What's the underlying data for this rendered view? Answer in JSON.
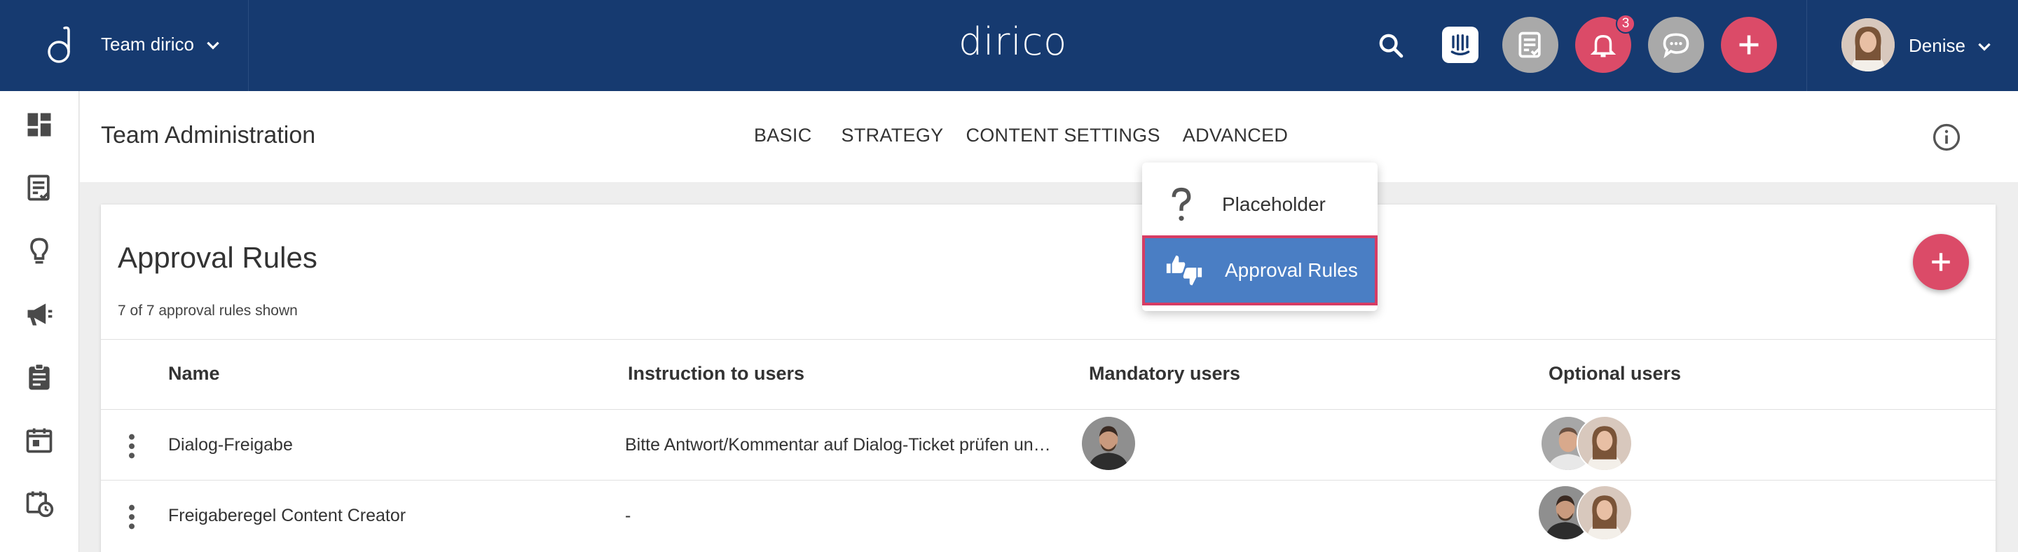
{
  "topbar": {
    "team_name": "Team dirico",
    "brand": "dirico",
    "notification_count": "3",
    "user_name": "Denise",
    "colors": {
      "bar": "#163a70",
      "accent": "#db4b68",
      "grey_btn": "#a9a9a9"
    }
  },
  "sidebar": {
    "items": [
      {
        "icon": "dashboard-icon"
      },
      {
        "icon": "task-list-icon"
      },
      {
        "icon": "lightbulb-icon"
      },
      {
        "icon": "megaphone-icon"
      },
      {
        "icon": "clipboard-icon"
      },
      {
        "icon": "calendar-icon"
      },
      {
        "icon": "calendar-clock-icon"
      }
    ]
  },
  "header": {
    "title": "Team Administration",
    "tabs": [
      {
        "label": "BASIC"
      },
      {
        "label": "STRATEGY"
      },
      {
        "label": "CONTENT SETTINGS"
      },
      {
        "label": "ADVANCED"
      }
    ]
  },
  "dropdown": {
    "items": [
      {
        "label": "Placeholder",
        "icon": "question-mark-icon"
      },
      {
        "label": "Approval Rules",
        "icon": "thumbs-up-down-icon",
        "selected": true
      }
    ]
  },
  "card": {
    "title": "Approval Rules",
    "subtitle": "7 of 7 approval rules shown",
    "columns": [
      "Name",
      "Instruction to users",
      "Mandatory users",
      "Optional users"
    ],
    "rows": [
      {
        "name": "Dialog-Freigabe",
        "instruction": "Bitte Antwort/Kommentar auf Dialog-Ticket prüfen un…"
      },
      {
        "name": "Freigaberegel Content Creator",
        "instruction": "-"
      }
    ]
  }
}
